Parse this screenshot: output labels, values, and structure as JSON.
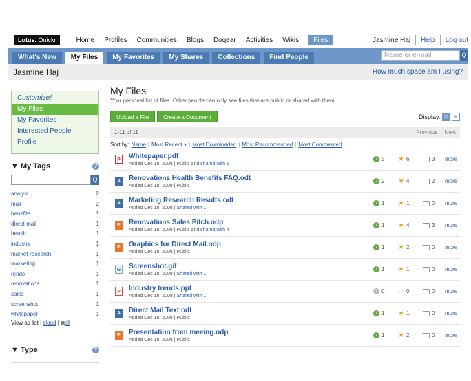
{
  "app": {
    "logo_brand": "Lotus.",
    "logo_product": "Quickr"
  },
  "topnav": {
    "items": [
      "Home",
      "Profiles",
      "Communities",
      "Blogs",
      "Dogear",
      "Activities",
      "Wikis",
      "Files"
    ],
    "active": "Files",
    "user": "Jasmine Haj",
    "help": "Help",
    "logout": "Log out"
  },
  "tabs": [
    {
      "label": "What's New"
    },
    {
      "label": "My Files"
    },
    {
      "label": "My Favorites"
    },
    {
      "label": "My Shares"
    },
    {
      "label": "Collections"
    },
    {
      "label": "Find People"
    }
  ],
  "search": {
    "placeholder": "Name or e-mail",
    "button": "Q"
  },
  "userbar": {
    "name": "Jasmine Haj",
    "space_link": "How much space am I using?"
  },
  "sidebar": {
    "customize": "Customize!",
    "items": [
      "My Files",
      "My Favorites",
      "Interested People",
      "Profile"
    ],
    "tags_heading": "▼ My Tags",
    "help": "?",
    "tag_search_button": "Q",
    "tags": [
      {
        "name": "analyst",
        "count": "2"
      },
      {
        "name": "mail",
        "count": "2"
      },
      {
        "name": "benefits",
        "count": "1"
      },
      {
        "name": "direct-mail",
        "count": "1"
      },
      {
        "name": "health",
        "count": "1"
      },
      {
        "name": "industry",
        "count": "1"
      },
      {
        "name": "market-research",
        "count": "1"
      },
      {
        "name": "marketing",
        "count": "1"
      },
      {
        "name": "rends",
        "count": "1"
      },
      {
        "name": "renovations",
        "count": "1"
      },
      {
        "name": "sales",
        "count": "1"
      },
      {
        "name": "screenshot",
        "count": "1"
      },
      {
        "name": "whitepaper",
        "count": "1"
      }
    ],
    "view_as_prefix": "View as list",
    "view_cloud": "cloud",
    "view_all": "all",
    "type_heading": "▼ Type"
  },
  "main": {
    "title": "My Files",
    "description": "Your personal list of files. Other people can only see files that are public or shared with them.",
    "upload_button": "Upload a File",
    "create_button": "Create a Document",
    "display_label": "Display:",
    "pager_count": "1-11 of 11",
    "previous": "Previous",
    "next": "Next",
    "sort_label": "Sort by:",
    "sort_options": [
      "Name",
      "Most Recent ▾",
      "Most Downloaded",
      "Most Recommended",
      "Most Commented"
    ],
    "more_label": "more"
  },
  "files": [
    {
      "name": "Whitepaper.pdf",
      "type": "pdf",
      "icon": "P",
      "meta": "Added Dec 18, 2008  |  Public and ",
      "share": "shared with 1",
      "downloads": "3",
      "rating": "6",
      "comments": "3"
    },
    {
      "name": "Renovations Health Benefits FAQ.odt",
      "type": "odt",
      "icon": "A",
      "meta": "Added Dec 18, 2008  |  Public",
      "share": "",
      "downloads": "2",
      "rating": "4",
      "comments": "2"
    },
    {
      "name": "Marketing Research Results.odt",
      "type": "odt",
      "icon": "A",
      "meta": "Added Dec 18, 2008  |  ",
      "share": "Shared with 1",
      "downloads": "1",
      "rating": "1",
      "comments": "0"
    },
    {
      "name": "Renovations Sales Pitch.odp",
      "type": "odp",
      "icon": "P",
      "meta": "Added Dec 18, 2008  |  Public and ",
      "share": "shared with 4",
      "downloads": "1",
      "rating": "4",
      "comments": "3"
    },
    {
      "name": "Graphics for Direct Mail.odp",
      "type": "odp",
      "icon": "P",
      "meta": "Added Dec 18, 2008  |  Public",
      "share": "",
      "downloads": "1",
      "rating": "2",
      "comments": "0"
    },
    {
      "name": "Screenshot.gif",
      "type": "gif",
      "icon": "G",
      "meta": "Added Dec 18, 2008  |  ",
      "share": "Shared with 1",
      "downloads": "1",
      "rating": "1",
      "comments": "0"
    },
    {
      "name": "Industry trends.ppt",
      "type": "ppt",
      "icon": "P",
      "meta": "Added Dec 18, 2008  |  ",
      "share": "Shared with 1",
      "downloads": "0",
      "rating": "0",
      "comments": "0"
    },
    {
      "name": "Direct Mail Text.odt",
      "type": "odt",
      "icon": "A",
      "meta": "Added Dec 18, 2008  |  Public",
      "share": "",
      "downloads": "1",
      "rating": "1",
      "comments": "0"
    },
    {
      "name": "Presentation from meeing.odp",
      "type": "odp",
      "icon": "P",
      "meta": "Added Dec 18, 2008  |  Public",
      "share": "",
      "downloads": "1",
      "rating": "2",
      "comments": "0"
    }
  ]
}
